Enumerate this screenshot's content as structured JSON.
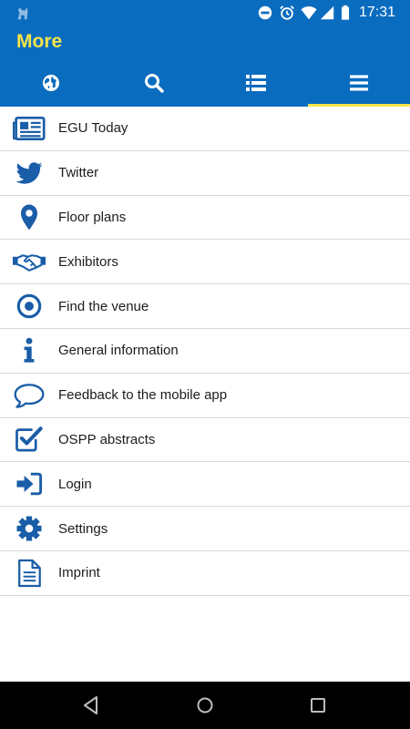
{
  "status_bar": {
    "time": "17:31",
    "icons": [
      "app-notification-icon",
      "do-not-disturb-icon",
      "alarm-icon",
      "wifi-icon",
      "signal-icon",
      "battery-icon"
    ]
  },
  "app_bar": {
    "title": "More"
  },
  "tabs": [
    {
      "icon": "globe-icon",
      "active": false
    },
    {
      "icon": "search-icon",
      "active": false
    },
    {
      "icon": "list-icon",
      "active": false
    },
    {
      "icon": "menu-icon",
      "active": true
    }
  ],
  "menu": {
    "items": [
      {
        "label": "EGU Today",
        "icon": "newspaper-icon"
      },
      {
        "label": "Twitter",
        "icon": "twitter-icon"
      },
      {
        "label": "Floor plans",
        "icon": "map-pin-icon"
      },
      {
        "label": "Exhibitors",
        "icon": "handshake-icon"
      },
      {
        "label": "Find the venue",
        "icon": "target-icon"
      },
      {
        "label": "General information",
        "icon": "info-icon"
      },
      {
        "label": "Feedback to the mobile app",
        "icon": "speech-bubble-icon"
      },
      {
        "label": "OSPP abstracts",
        "icon": "checkbox-icon"
      },
      {
        "label": "Login",
        "icon": "sign-in-icon"
      },
      {
        "label": "Settings",
        "icon": "gear-icon"
      },
      {
        "label": "Imprint",
        "icon": "document-icon"
      }
    ]
  },
  "colors": {
    "primary": "#0a6cbf",
    "accent": "#f5e44a",
    "icon": "#1a5da8",
    "divider": "#d9d9d9"
  }
}
